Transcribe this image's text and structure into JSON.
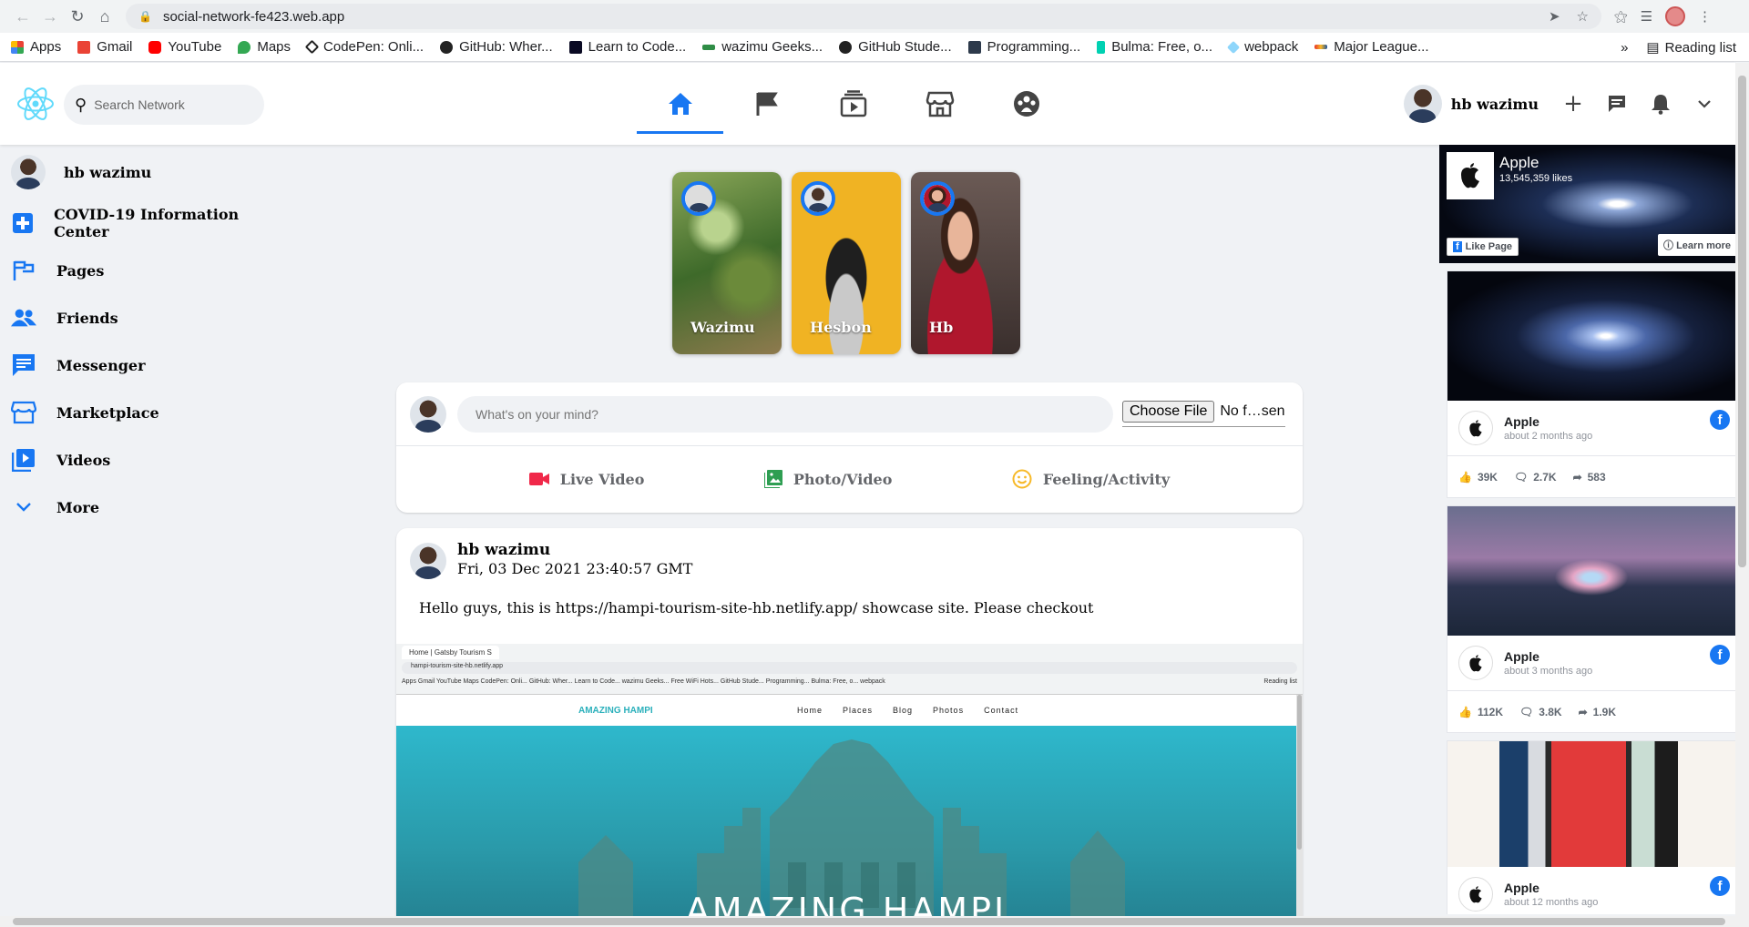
{
  "browser": {
    "url": "social-network-fe423.web.app",
    "bookmarks": [
      "Apps",
      "Gmail",
      "YouTube",
      "Maps",
      "CodePen: Onli...",
      "GitHub: Wher...",
      "Learn to Code...",
      "wazimu Geeks...",
      "GitHub Stude...",
      "Programming...",
      "Bulma: Free, o...",
      "webpack",
      "Major League..."
    ],
    "reading_list": "Reading list",
    "more_chevron": "»"
  },
  "header": {
    "search_placeholder": "Search Network",
    "user_name": "hb wazimu",
    "nav_icons": [
      "home-icon",
      "flag-icon",
      "watch-icon",
      "marketplace-icon",
      "groups-icon"
    ],
    "active_tab": "home",
    "accent": "#1877f2"
  },
  "sidebar": {
    "user_name": "hb wazimu",
    "items": [
      {
        "label": "COVID-19 Information Center",
        "icon": "covid-plus-icon"
      },
      {
        "label": "Pages",
        "icon": "pages-flag-icon"
      },
      {
        "label": "Friends",
        "icon": "friends-icon"
      },
      {
        "label": "Messenger",
        "icon": "messenger-icon"
      },
      {
        "label": "Marketplace",
        "icon": "marketplace-icon"
      },
      {
        "label": "Videos",
        "icon": "videos-icon"
      },
      {
        "label": "More",
        "icon": "chevron-down-icon"
      }
    ]
  },
  "stories": [
    {
      "name": "Wazimu"
    },
    {
      "name": "Hesbon"
    },
    {
      "name": "Hb"
    }
  ],
  "composer": {
    "placeholder": "What's on your mind?",
    "file_button": "Choose File",
    "file_status": "No f…sen",
    "actions": [
      {
        "label": "Live Video",
        "color": "#f02849"
      },
      {
        "label": "Photo/Video",
        "color": "#45bd62"
      },
      {
        "label": "Feeling/Activity",
        "color": "#f7b928"
      }
    ]
  },
  "post": {
    "author": "hb wazimu",
    "date": "Fri, 03 Dec 2021 23:40:57 GMT",
    "text": "Hello guys, this is https://hampi-tourism-site-hb.netlify.app/ showcase site. Please checkout",
    "image": {
      "tab_title": "Home | Gatsby Tourism S",
      "url": "hampi-tourism-site-hb.netlify.app",
      "bookmarks": "Apps   Gmail   YouTube   Maps   CodePen: Onli...   GitHub: Wher...   Learn to Code...   wazimu Geeks...   Free WiFi Hots...   GitHub Stude...   Programming...   Bulma: Free, o...   webpack",
      "reading_list": "Reading list",
      "logo": "AMAZING HAMPI",
      "nav": [
        "Home",
        "Places",
        "Blog",
        "Photos",
        "Contact"
      ],
      "hero_title": "AMAZING HAMPI"
    }
  },
  "right_sidebar": {
    "page": {
      "name": "Apple",
      "likes": "13,545,359 likes",
      "like_button": "Like Page",
      "learn_button": "Learn more"
    },
    "posts": [
      {
        "name": "Apple",
        "time": "about 2 months ago",
        "likes": "39K",
        "comments": "2.7K",
        "shares": "583"
      },
      {
        "name": "Apple",
        "time": "about 3 months ago",
        "likes": "112K",
        "comments": "3.8K",
        "shares": "1.9K"
      },
      {
        "name": "Apple",
        "time": "about 12 months ago",
        "likes": "",
        "comments": "",
        "shares": ""
      }
    ]
  }
}
